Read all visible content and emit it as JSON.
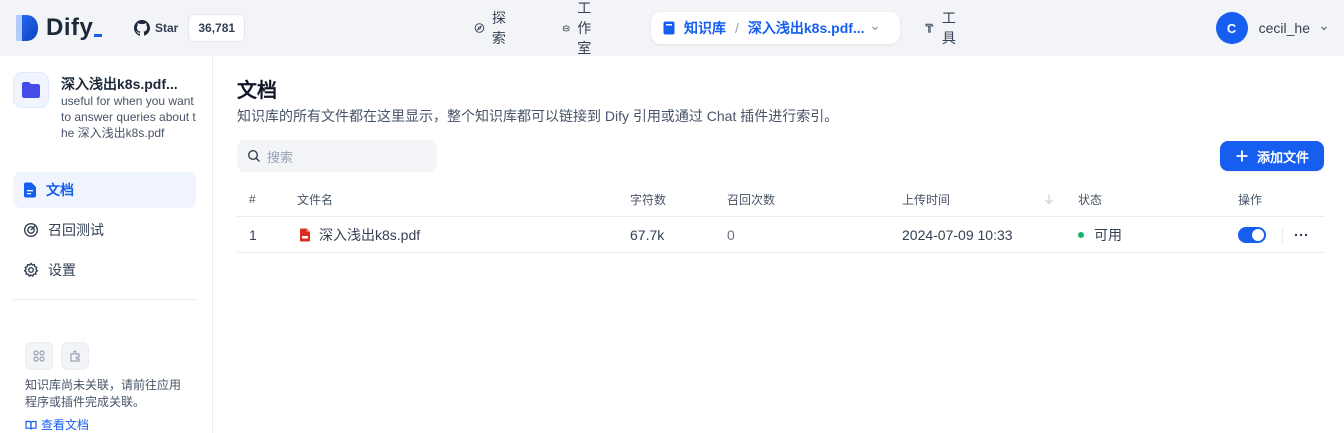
{
  "header": {
    "brand": "Dify",
    "github": {
      "label": "Star",
      "count": "36,781"
    },
    "nav": [
      {
        "label": "探索",
        "icon": "compass-icon"
      },
      {
        "label": "工作室",
        "icon": "robot-icon"
      },
      {
        "label": "知识库",
        "icon": "book-icon"
      },
      {
        "label": "工具",
        "icon": "hammer-icon"
      }
    ],
    "breadcrumb_current": "深入浅出k8s.pdf...",
    "user": {
      "initial": "C",
      "name": "cecil_he"
    }
  },
  "sidebar": {
    "kb_name": "深入浅出k8s.pdf...",
    "kb_description": "useful for when you want to answer queries about the 深入浅出k8s.pdf",
    "items": [
      {
        "label": "文档",
        "icon": "document-icon",
        "active": true
      },
      {
        "label": "召回测试",
        "icon": "target-icon",
        "active": false
      },
      {
        "label": "设置",
        "icon": "gear-icon",
        "active": false
      }
    ],
    "footer_text": "知识库尚未关联，请前往应用程序或插件完成关联。",
    "footer_link": "查看文档"
  },
  "main": {
    "title": "文档",
    "description": "知识库的所有文件都在这里显示，整个知识库都可以链接到 Dify 引用或通过 Chat 插件进行索引。",
    "search_placeholder": "搜索",
    "add_button": "添加文件",
    "table": {
      "columns": [
        "#",
        "文件名",
        "字符数",
        "召回次数",
        "上传时间",
        "状态",
        "操作"
      ],
      "rows": [
        {
          "index": "1",
          "file_name": "深入浅出k8s.pdf",
          "chars": "67.7k",
          "hits": "0",
          "upload_time": "2024-07-09 10:33",
          "status": "可用",
          "enabled": true
        }
      ]
    }
  },
  "colors": {
    "accent": "#155eef",
    "status_available": "#12b76a",
    "background": "#f2f4f7"
  }
}
